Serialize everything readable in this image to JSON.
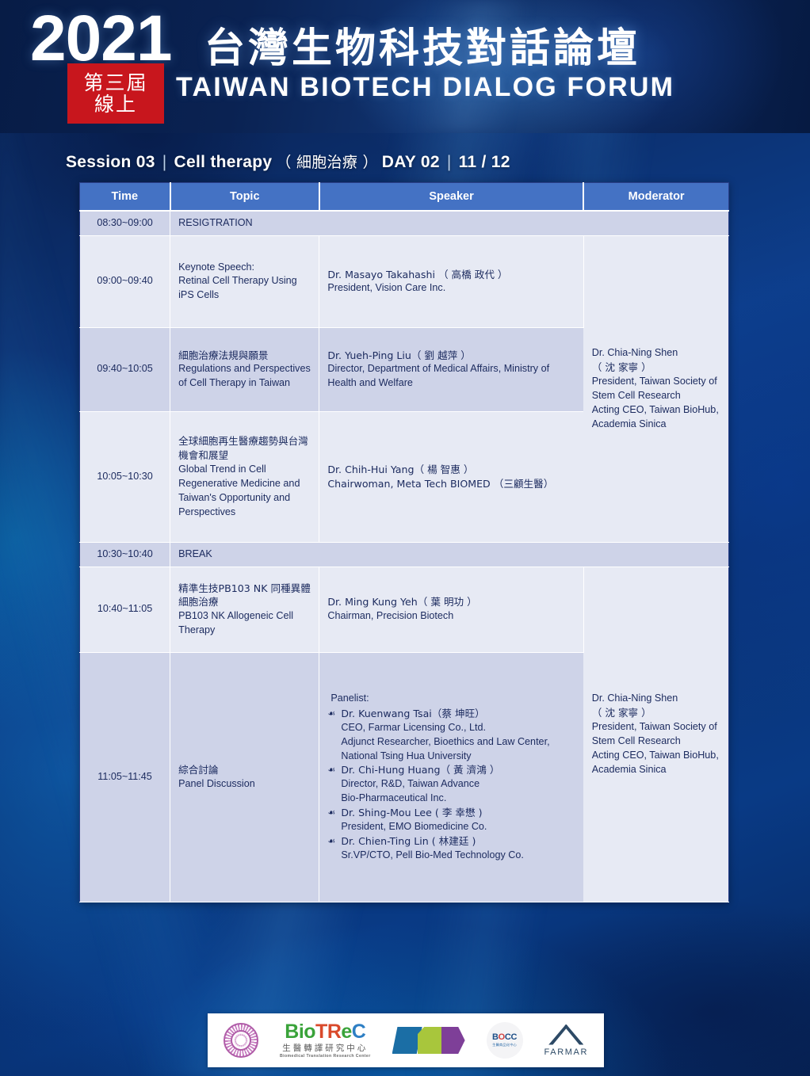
{
  "banner": {
    "year": "2021",
    "badge_line1": "第三屆",
    "badge_line2": "線上",
    "title_cn": "台灣生物科技對話論壇",
    "title_en": "TAIWAN BIOTECH DIALOG FORUM"
  },
  "session": {
    "label": "Session 03",
    "topic": "Cell therapy",
    "topic_cn": "（ 細胞治療 ）",
    "day": "DAY 02",
    "date": "11 / 12",
    "sep": "|"
  },
  "table": {
    "headers": [
      "Time",
      "Topic",
      "Speaker",
      "Moderator"
    ],
    "rows": [
      {
        "type": "band",
        "time": "08:30~09:00",
        "topic": "RESIGTRATION"
      },
      {
        "type": "session",
        "time": "09:00~09:40",
        "topic_cn": "",
        "topic_en": "Keynote Speech:\nRetinal Cell Therapy Using iPS Cells",
        "speaker_name": "Dr. Masayo Takahashi （ 高橋 政代 ）",
        "speaker_title": "President, Vision Care Inc."
      },
      {
        "type": "session",
        "time": "09:40~10:05",
        "topic_cn": "細胞治療法規與願景",
        "topic_en": "Regulations and Perspectives of Cell Therapy in Taiwan",
        "speaker_name": "Dr. Yueh-Ping Liu（ 劉 越萍 ）",
        "speaker_title": "Director, Department of Medical Affairs, Ministry of Health and Welfare"
      },
      {
        "type": "session",
        "time": "10:05~10:30",
        "topic_cn": "全球細胞再生醫療趨勢與台灣機會和展望",
        "topic_en": "Global Trend in Cell Regenerative Medicine and Taiwan's Opportunity and Perspectives",
        "speaker_name": "Dr. Chih-Hui Yang（ 楊 智惠 ）",
        "speaker_title": "Chairwoman, Meta Tech BIOMED （三顧生醫）"
      },
      {
        "type": "band",
        "time": "10:30~10:40",
        "topic": "BREAK"
      },
      {
        "type": "session",
        "time": "10:40~11:05",
        "topic_cn": "精準生技PB103 NK 同種異體細胞治療",
        "topic_en": "PB103 NK Allogeneic Cell Therapy",
        "speaker_name": "Dr. Ming Kung Yeh（ 葉 明功 ）",
        "speaker_title": "Chairman, Precision Biotech"
      },
      {
        "type": "panel",
        "time": "11:05~11:45",
        "topic_cn": "綜合討論",
        "topic_en": "Panel Discussion",
        "panelist_label": "Panelist:",
        "bullet": "☙",
        "panelists": [
          {
            "name": "Dr. Kuenwang Tsai（蔡 坤旺）",
            "lines": [
              "CEO, Farmar Licensing Co., Ltd.",
              "Adjunct Researcher, Bioethics and Law Center,",
              "National Tsing Hua University"
            ]
          },
          {
            "name": "Dr. Chi-Hung Huang（ 黃 濟鴻 ）",
            "lines": [
              "Director, R&D, Taiwan Advance",
              "Bio-Pharmaceutical Inc."
            ]
          },
          {
            "name": "Dr. Shing-Mou Lee ( 李 幸懋 )",
            "lines": [
              "President, EMO Biomedicine Co."
            ]
          },
          {
            "name": "Dr. Chien-Ting Lin ( 林建廷 )",
            "lines": [
              "Sr.VP/CTO, Pell Bio-Med Technology Co."
            ]
          }
        ]
      }
    ],
    "moderators": [
      {
        "name": "Dr. Chia-Ning Shen",
        "name_cn": "（ 沈 家寧 ）",
        "lines": [
          "President, Taiwan Society of",
          "Stem Cell Research",
          "Acting CEO, Taiwan BioHub,",
          "Academia Sinica"
        ]
      },
      {
        "name": "Dr. Chia-Ning Shen",
        "name_cn": "（ 沈 家寧 ）",
        "lines": [
          "President, Taiwan Society of",
          "Stem Cell Research",
          "Acting CEO, Taiwan BioHub,",
          "Academia Sinica"
        ]
      }
    ]
  },
  "logos": [
    {
      "id": "nhri-seal",
      "name": ""
    },
    {
      "id": "biotrec",
      "w1": "Bio",
      "w2": "TR",
      "w3": "e",
      "w4": "C",
      "cn": "生醫轉譯研究中心",
      "en": "Biomedical Translation Research Center"
    },
    {
      "id": "dcb",
      "name": "DCB"
    },
    {
      "id": "bocc",
      "t1": "B",
      "t2": "O",
      "t3": "CC",
      "cn": "生醫商品化中心"
    },
    {
      "id": "farmar",
      "name": "FARMAR"
    }
  ],
  "colors": {
    "header_blue": "#4472c4",
    "badge_red": "#c8161d",
    "row_light": "#e7eaf4",
    "row_dark": "#ced3e8",
    "text_navy": "#1b2a5e",
    "bg_blue": "#0a2f6e"
  }
}
